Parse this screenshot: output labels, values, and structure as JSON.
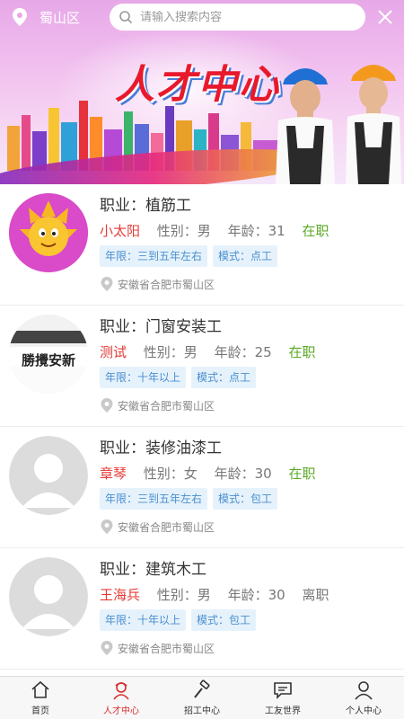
{
  "location": {
    "text": "蜀山区"
  },
  "search": {
    "placeholder": "请输入搜索内容"
  },
  "banner": {
    "title": "人才中心"
  },
  "workers": [
    {
      "job": "职业：植筋工",
      "name": "小太阳",
      "gender": "性别：男",
      "age": "年龄：31",
      "status": "在职",
      "status_color": "#5aaa26",
      "years": "年限：三到五年左右",
      "mode": "模式：点工",
      "address": "安徽省合肥市蜀山区",
      "avatar": "cartoon-sun"
    },
    {
      "job": "职业：门窗安装工",
      "name": "测试",
      "gender": "性别：男",
      "age": "年龄：25",
      "status": "在职",
      "status_color": "#5aaa26",
      "years": "年限：十年以上",
      "mode": "模式：点工",
      "address": "安徽省合肥市蜀山区",
      "avatar": "photo-sign",
      "avatar_text": "勝攪安新"
    },
    {
      "job": "职业：装修油漆工",
      "name": "章琴",
      "gender": "性别：女",
      "age": "年龄：30",
      "status": "在职",
      "status_color": "#5aaa26",
      "years": "年限：三到五年左右",
      "mode": "模式：包工",
      "address": "安徽省合肥市蜀山区",
      "avatar": "default"
    },
    {
      "job": "职业：建筑木工",
      "name": "王海兵",
      "gender": "性别：男",
      "age": "年龄：30",
      "status": "离职",
      "status_color": "#777777",
      "years": "年限：十年以上",
      "mode": "模式：包工",
      "address": "安徽省合肥市蜀山区",
      "avatar": "default"
    }
  ],
  "nav": [
    {
      "label": "首页",
      "icon": "home-icon",
      "active": false
    },
    {
      "label": "人才中心",
      "icon": "talent-icon",
      "active": true
    },
    {
      "label": "招工中心",
      "icon": "hammer-icon",
      "active": false
    },
    {
      "label": "工友世界",
      "icon": "chat-icon",
      "active": false
    },
    {
      "label": "个人中心",
      "icon": "person-icon",
      "active": false
    }
  ],
  "colors": {
    "accent": "#d92d2d",
    "name": "#e53935",
    "tag_bg": "#e6f2fb",
    "tag_text": "#4a8fd0"
  }
}
